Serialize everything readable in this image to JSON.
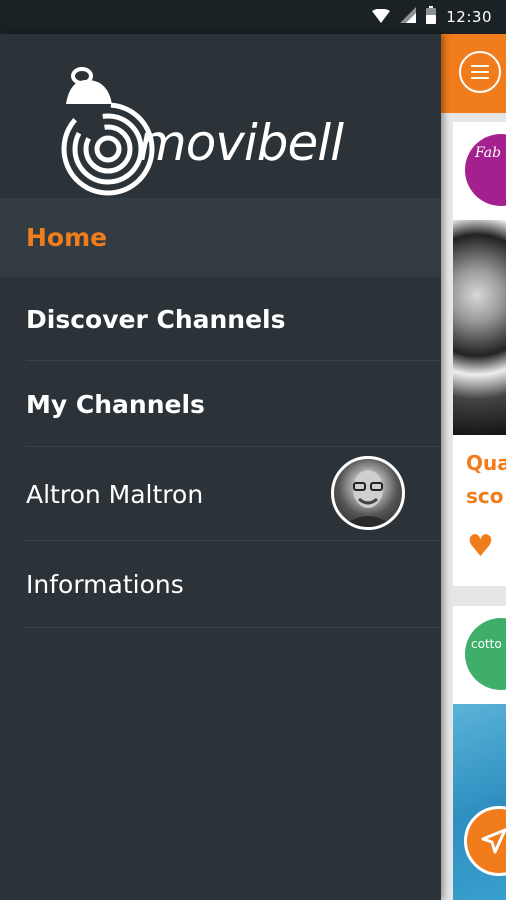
{
  "status_bar": {
    "time": "12:30"
  },
  "brand": {
    "name": "movibell"
  },
  "drawer": {
    "items": [
      {
        "label": "Home",
        "active": true
      },
      {
        "label": "Discover Channels"
      },
      {
        "label": "My Channels"
      },
      {
        "label": "Altron Maltron",
        "has_avatar": true
      },
      {
        "label": "Informations"
      }
    ]
  },
  "background_content": {
    "card1": {
      "channel_logo_text": "Fab ou",
      "title_line1": "Qua",
      "title_line2": "sco"
    },
    "card2": {
      "channel_logo_text": "cotto te"
    }
  },
  "colors": {
    "accent": "#f07c1c",
    "drawer_bg": "#2b3338",
    "active_item_bg": "#333c42"
  }
}
